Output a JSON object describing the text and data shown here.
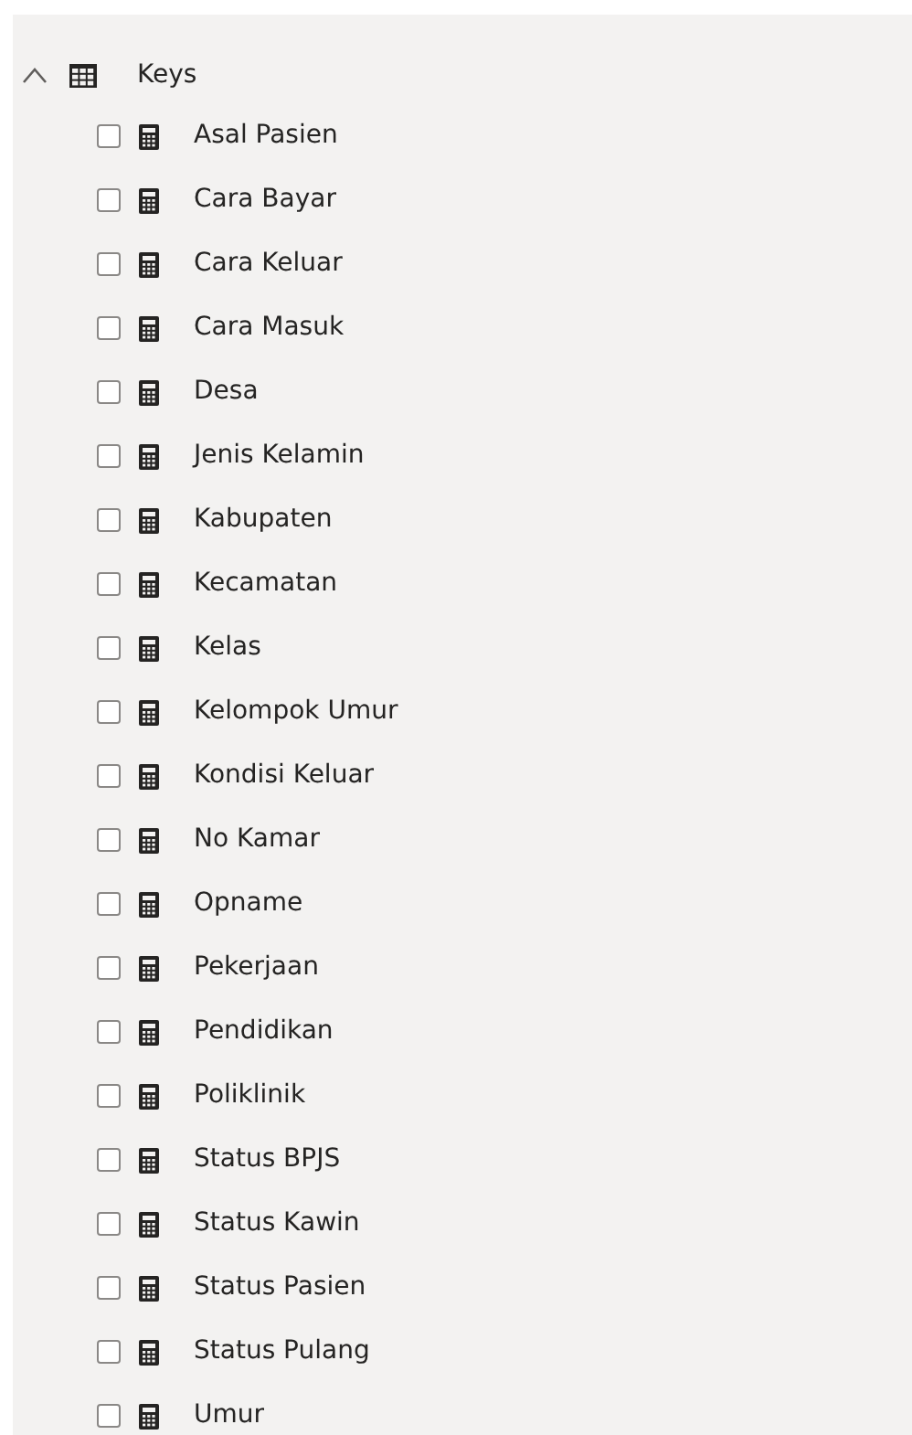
{
  "table": {
    "name": "Keys",
    "expanded": true,
    "fields": [
      {
        "name": "Asal Pasien",
        "checked": false
      },
      {
        "name": "Cara Bayar",
        "checked": false
      },
      {
        "name": "Cara Keluar",
        "checked": false
      },
      {
        "name": "Cara Masuk",
        "checked": false
      },
      {
        "name": "Desa",
        "checked": false
      },
      {
        "name": "Jenis Kelamin",
        "checked": false
      },
      {
        "name": "Kabupaten",
        "checked": false
      },
      {
        "name": "Kecamatan",
        "checked": false
      },
      {
        "name": "Kelas",
        "checked": false
      },
      {
        "name": "Kelompok Umur",
        "checked": false
      },
      {
        "name": "Kondisi Keluar",
        "checked": false
      },
      {
        "name": "No Kamar",
        "checked": false
      },
      {
        "name": "Opname",
        "checked": false
      },
      {
        "name": "Pekerjaan",
        "checked": false
      },
      {
        "name": "Pendidikan",
        "checked": false
      },
      {
        "name": "Poliklinik",
        "checked": false
      },
      {
        "name": "Status BPJS",
        "checked": false
      },
      {
        "name": "Status Kawin",
        "checked": false
      },
      {
        "name": "Status Pasien",
        "checked": false
      },
      {
        "name": "Status Pulang",
        "checked": false
      },
      {
        "name": "Umur",
        "checked": false
      }
    ]
  }
}
